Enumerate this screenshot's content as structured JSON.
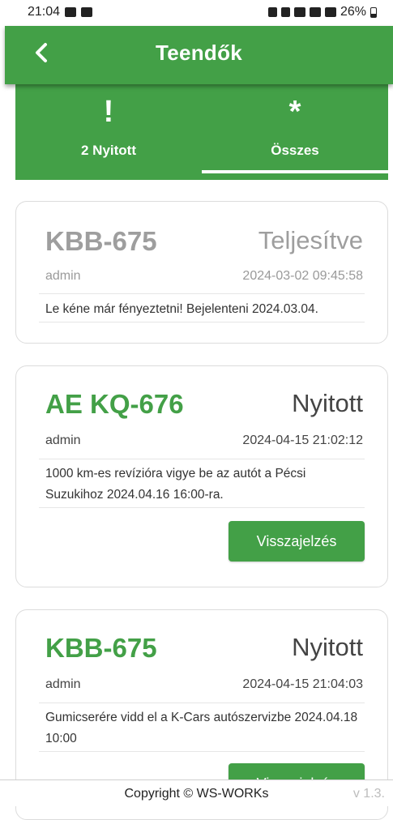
{
  "status_bar": {
    "time": "21:04",
    "battery": "26%",
    "left_icons": [
      "mail-icon",
      "image-icon"
    ],
    "right_icons": [
      "sim-icon",
      "alarm-icon",
      "wifi-icon",
      "signal-icon",
      "call-signal-icon",
      "battery-icon"
    ]
  },
  "header": {
    "title": "Teendők",
    "back_icon": "chevron-left-icon"
  },
  "tabs": [
    {
      "icon": "!",
      "label": "2 Nyitott",
      "active": false
    },
    {
      "icon": "*",
      "label": "Összes",
      "active": true
    }
  ],
  "tasks": [
    {
      "plate": "KBB-675",
      "status": "Teljesítve",
      "user": "admin",
      "date": "2024-03-02 09:45:58",
      "note": "Le kéne már fényeztetni! Bejelenteni 2024.03.04."
    },
    {
      "plate": "AE KQ-676",
      "status": "Nyitott",
      "user": "admin",
      "date": "2024-04-15 21:02:12",
      "note": "1000 km-es revízióra vigye be az autót a Pécsi Suzukihoz 2024.04.16 16:00-ra.",
      "button": "Visszajelzés"
    },
    {
      "plate": "KBB-675",
      "status": "Nyitott",
      "user": "admin",
      "date": "2024-04-15 21:04:03",
      "note": "Gumicserére vidd el a K-Cars autószervizbe 2024.04.18 10:00",
      "button": "Visszajelzés"
    }
  ],
  "footer": {
    "copyright": "Copyright © WS-WORKs",
    "version": "v 1.3."
  },
  "colors": {
    "primary": "#43a047",
    "muted": "#9e9e9e"
  }
}
